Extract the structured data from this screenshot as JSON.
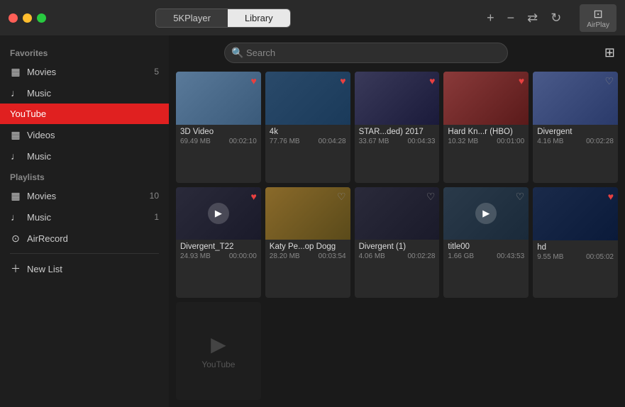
{
  "titlebar": {
    "tab_player": "5KPlayer",
    "tab_library": "Library",
    "active_tab": "Library",
    "action_add": "+",
    "action_minus": "−",
    "action_shuffle": "⇄",
    "action_refresh": "↻",
    "airplay_label": "AirPlay"
  },
  "sidebar": {
    "favorites_label": "Favorites",
    "favorites_items": [
      {
        "id": "fav-movies",
        "icon": "▦",
        "label": "Movies",
        "count": "5"
      },
      {
        "id": "fav-music",
        "icon": "♩",
        "label": "Music",
        "count": ""
      }
    ],
    "youtube_label": "YouTube",
    "youtube_items": [
      {
        "id": "yt-videos",
        "icon": "▦",
        "label": "Videos",
        "count": ""
      },
      {
        "id": "yt-music",
        "icon": "♩",
        "label": "Music",
        "count": ""
      }
    ],
    "playlists_label": "Playlists",
    "playlists_items": [
      {
        "id": "pl-movies",
        "icon": "▦",
        "label": "Movies",
        "count": "10"
      },
      {
        "id": "pl-music",
        "icon": "♩",
        "label": "Music",
        "count": "1"
      },
      {
        "id": "pl-airrecord",
        "icon": "⊙",
        "label": "AirRecord",
        "count": ""
      }
    ],
    "new_list_label": "New List"
  },
  "search": {
    "placeholder": "Search"
  },
  "videos": [
    {
      "id": "v1",
      "title": "3D Video",
      "size": "69.49 MB",
      "duration": "00:02:10",
      "heart": true,
      "heart_color": "#e84040",
      "thumb_class": "thumb-3dvideo",
      "show_play": false
    },
    {
      "id": "v2",
      "title": "4k",
      "size": "77.76 MB",
      "duration": "00:04:28",
      "heart": true,
      "heart_color": "#e84040",
      "thumb_class": "thumb-4k",
      "show_play": false
    },
    {
      "id": "v3",
      "title": "STAR...ded) 2017",
      "size": "33.67 MB",
      "duration": "00:04:33",
      "heart": true,
      "heart_color": "#e84040",
      "thumb_class": "thumb-star",
      "show_play": false
    },
    {
      "id": "v4",
      "title": "Hard Kn...r (HBO)",
      "size": "10.32 MB",
      "duration": "00:01:00",
      "heart": true,
      "heart_color": "#e84040",
      "thumb_class": "thumb-hardknock",
      "show_play": false
    },
    {
      "id": "v5",
      "title": "Divergent",
      "size": "4.16 MB",
      "duration": "00:02:28",
      "heart": false,
      "heart_color": "#888",
      "thumb_class": "thumb-divergent",
      "show_play": false
    },
    {
      "id": "v6",
      "title": "Divergent_T22",
      "size": "24.93 MB",
      "duration": "00:00:00",
      "heart": true,
      "heart_color": "#e84040",
      "thumb_class": "thumb-divergent2",
      "show_play": true
    },
    {
      "id": "v7",
      "title": "Katy Pe...op Dogg",
      "size": "28.20 MB",
      "duration": "00:03:54",
      "heart": false,
      "heart_color": "#888",
      "thumb_class": "thumb-katy",
      "show_play": false
    },
    {
      "id": "v8",
      "title": "Divergent (1)",
      "size": "4.06 MB",
      "duration": "00:02:28",
      "heart": false,
      "heart_color": "#888",
      "thumb_class": "thumb-divergent3",
      "show_play": false
    },
    {
      "id": "v9",
      "title": "title00",
      "size": "1.66 GB",
      "duration": "00:43:53",
      "heart": false,
      "heart_color": "#888",
      "thumb_class": "thumb-title00",
      "show_play": true
    },
    {
      "id": "v10",
      "title": "hd",
      "size": "9.55 MB",
      "duration": "00:05:02",
      "heart": true,
      "heart_color": "#e84040",
      "thumb_class": "thumb-hd",
      "show_play": false
    }
  ],
  "youtube_placeholder": {
    "icon": "▶",
    "label": "YouTube"
  }
}
